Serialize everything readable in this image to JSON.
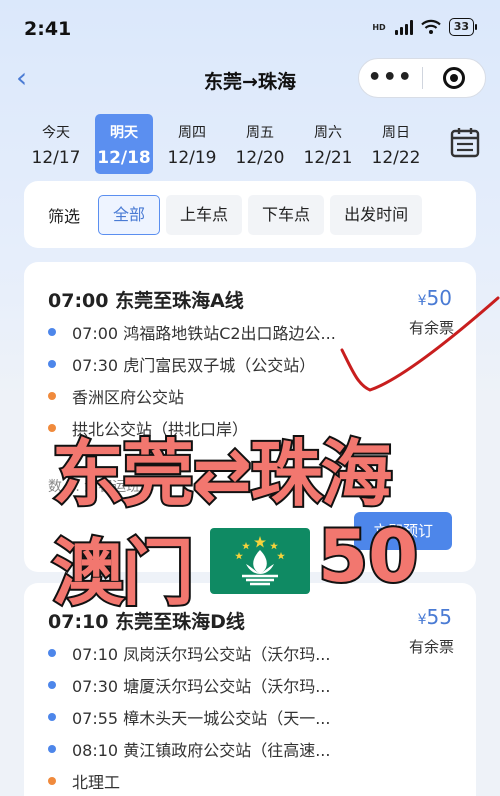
{
  "status": {
    "time": "2:41",
    "network": "HD",
    "battery": "33"
  },
  "nav": {
    "title": "东莞→珠海",
    "more_label": "•••"
  },
  "dates": [
    {
      "day": "今天",
      "date": "12/17"
    },
    {
      "day": "明天",
      "date": "12/18"
    },
    {
      "day": "周四",
      "date": "12/19"
    },
    {
      "day": "周五",
      "date": "12/20"
    },
    {
      "day": "周六",
      "date": "12/21"
    },
    {
      "day": "周日",
      "date": "12/22"
    }
  ],
  "filter": {
    "label": "筛选",
    "chips": [
      "全部",
      "上车点",
      "下车点",
      "出发时间"
    ]
  },
  "routes": [
    {
      "title": "07:00 东莞至珠海A线",
      "currency": "¥",
      "price": "50",
      "availability": "有余票",
      "stops": [
        {
          "text": "07:00 鸿福路地铁站C2出口路边公...",
          "type": "pickup"
        },
        {
          "text": "07:30 虎门富民双子城（公交站）",
          "type": "pickup"
        },
        {
          "text": "香洲区府公交站",
          "type": "dropoff"
        },
        {
          "text": "拱北公交站（拱北口岸）",
          "type": "dropoff"
        }
      ],
      "note": "数 ... 划客运班车",
      "book_label": "立即预订"
    },
    {
      "title": "07:10 东莞至珠海D线",
      "currency": "¥",
      "price": "55",
      "availability": "有余票",
      "stops": [
        {
          "text": "07:10 凤岗沃尔玛公交站（沃尔玛...",
          "type": "pickup"
        },
        {
          "text": "07:30 塘厦沃尔玛公交站（沃尔玛...",
          "type": "pickup"
        },
        {
          "text": "07:55 樟木头天一城公交站（天一...",
          "type": "pickup"
        },
        {
          "text": "08:10 黄江镇政府公交站（往高速...",
          "type": "pickup"
        },
        {
          "text": "北理工",
          "type": "dropoff"
        }
      ]
    }
  ],
  "overlay": {
    "line1": "东莞⇄珠海",
    "line2": "澳门",
    "line2_number": "50"
  },
  "colors": {
    "accent": "#5b8ff0",
    "pickup": "#4d86ea",
    "dropoff": "#f08a3c",
    "overlay_text": "#f2776f"
  }
}
